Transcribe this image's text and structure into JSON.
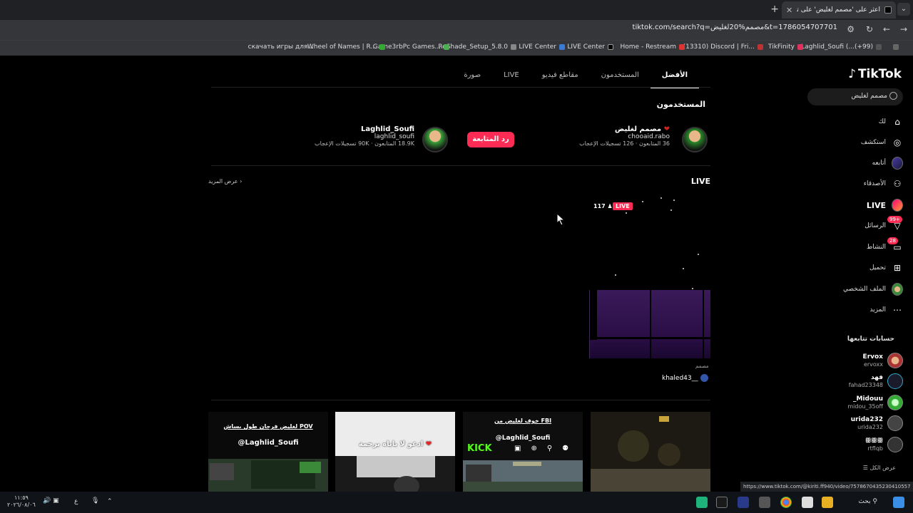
{
  "browser": {
    "tab_title": "اعثر على 'مصمم لغليض' على تيك",
    "url": "tiktok.com/search?q=مصمم%20لغليض&t=1786054707701",
    "bookmarks": [
      "Home - Restream",
      "(13310) Discord | Fri...",
      "TikFinity",
      "Laghlid_Soufi (...(+99)",
      "LIVE Center",
      "LIVE Center",
      "ReShade_Setup_5.8.0",
      "Game3rbPc Games...",
      "Wheel of Names | R...",
      "скачать игры для..."
    ]
  },
  "sidebar": {
    "brand": "TikTok",
    "search_value": "مصمم لغليض",
    "nav": [
      {
        "label": "لك",
        "icon": "home-icon"
      },
      {
        "label": "استكشف",
        "icon": "compass-icon"
      },
      {
        "label": "أتابعه",
        "icon": "following-avatar-icon"
      },
      {
        "label": "الأصدقاء",
        "icon": "friends-icon"
      },
      {
        "label": "LIVE",
        "icon": "live-avatar-icon"
      },
      {
        "label": "الرسائل",
        "icon": "messages-icon",
        "badge": "+99"
      },
      {
        "label": "النشاط",
        "icon": "activity-icon",
        "badge": "28"
      },
      {
        "label": "تحميل",
        "icon": "upload-icon"
      },
      {
        "label": "الملف الشخصي",
        "icon": "profile-avatar-icon"
      },
      {
        "label": "المزيد",
        "icon": "more-icon"
      }
    ],
    "following_title": "حسابات تتابعها",
    "following": [
      {
        "name": "Ervox",
        "user": "ervoxx"
      },
      {
        "name": "فهد",
        "user": "fahad23348"
      },
      {
        "name": "Midouu_",
        "user": "midou_35off"
      },
      {
        "name": "urida232",
        "user": "urida232"
      },
      {
        "name": "ꕥꕥꕥ",
        "user": "rtflqb"
      }
    ],
    "see_all": "عرض الكل"
  },
  "tabs": [
    "الأفضل",
    "المستخدمون",
    "مقاطع فيديو",
    "LIVE",
    "صورة"
  ],
  "users_section": {
    "title": "المستخدمون",
    "user1": {
      "name": "مصمم لغليض",
      "handle": "chooaid.rabo",
      "followers": "36 المتابعون",
      "likes": "126 تسجيلات الإعجاب"
    },
    "user2": {
      "name": "Laghlid_Soufi",
      "handle": "laghlid_soufi",
      "followers": "18.9K المتابعون",
      "likes": "90K تسجيلات الإعجاب"
    },
    "follow_back": "رد المتابعة"
  },
  "live_section": {
    "title": "LIVE",
    "see_more": "عرض المزيد",
    "live_badge": "LIVE",
    "viewers": "117",
    "category": "مصمم",
    "user": "khaled43__"
  },
  "videos": [
    {
      "caption_top": "خوف لغليض من FBI",
      "caption_mid": "@Laghlid_Soufi",
      "caption_brand": "KICK"
    },
    {
      "caption_top": "لغليض فرحان طول بساش POV",
      "caption_mid": "@Laghlid_Soufi"
    },
    {
      "caption_top": "ادعو لا باباه برحمة"
    }
  ],
  "status_url": "https://www.tiktok.com/@kiriti.ff940/video/7578670435230410557",
  "taskbar": {
    "search_label": "بحث",
    "lang": "ع",
    "time": "١١:٥٩",
    "date": "٢٠٢٦/٠٨/٠٦"
  },
  "colors": {
    "accent": "#fe2c55",
    "bg": "#000000"
  }
}
